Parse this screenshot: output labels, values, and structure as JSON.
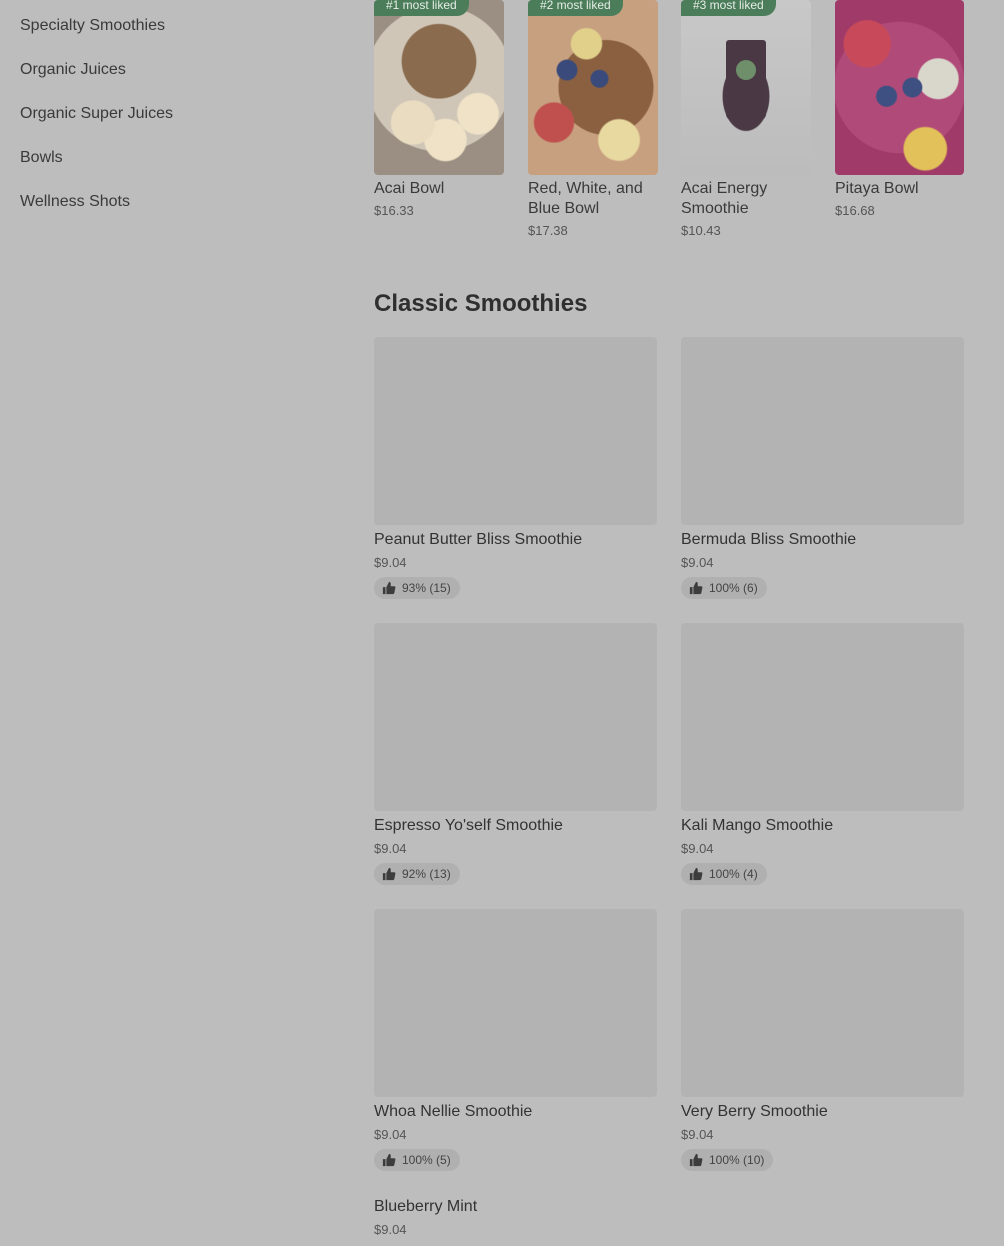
{
  "sidebar": {
    "items": [
      {
        "label": "Specialty Smoothies"
      },
      {
        "label": "Organic Juices"
      },
      {
        "label": "Organic Super Juices"
      },
      {
        "label": "Bowls"
      },
      {
        "label": "Wellness Shots"
      }
    ]
  },
  "popular": [
    {
      "badge": "#1 most liked",
      "name": "Acai Bowl",
      "price": "$16.33"
    },
    {
      "badge": "#2 most liked",
      "name": "Red, White, and Blue Bowl",
      "price": "$17.38"
    },
    {
      "badge": "#3 most liked",
      "name": "Acai Energy Smoothie",
      "price": "$10.43"
    },
    {
      "badge": "",
      "name": "Pitaya Bowl",
      "price": "$16.68"
    }
  ],
  "section": {
    "title": "Classic Smoothies",
    "items": [
      {
        "name": "Peanut Butter Bliss Smoothie",
        "price": "$9.04",
        "rating": "93% (15)"
      },
      {
        "name": "Bermuda Bliss Smoothie",
        "price": "$9.04",
        "rating": "100% (6)"
      },
      {
        "name": "Espresso Yo'self Smoothie",
        "price": "$9.04",
        "rating": "92% (13)"
      },
      {
        "name": "Kali Mango Smoothie",
        "price": "$9.04",
        "rating": "100% (4)"
      },
      {
        "name": "Whoa Nellie Smoothie",
        "price": "$9.04",
        "rating": "100% (5)"
      },
      {
        "name": "Very Berry Smoothie",
        "price": "$9.04",
        "rating": "100% (10)"
      },
      {
        "name": "Blueberry Mint",
        "price": "$9.04",
        "rating": ""
      }
    ]
  },
  "colors": {
    "badge_bg": "#4c7d5a",
    "overlay_bg": "#bdbdbd"
  },
  "icons": {
    "rating": "thumbs-up-icon"
  }
}
